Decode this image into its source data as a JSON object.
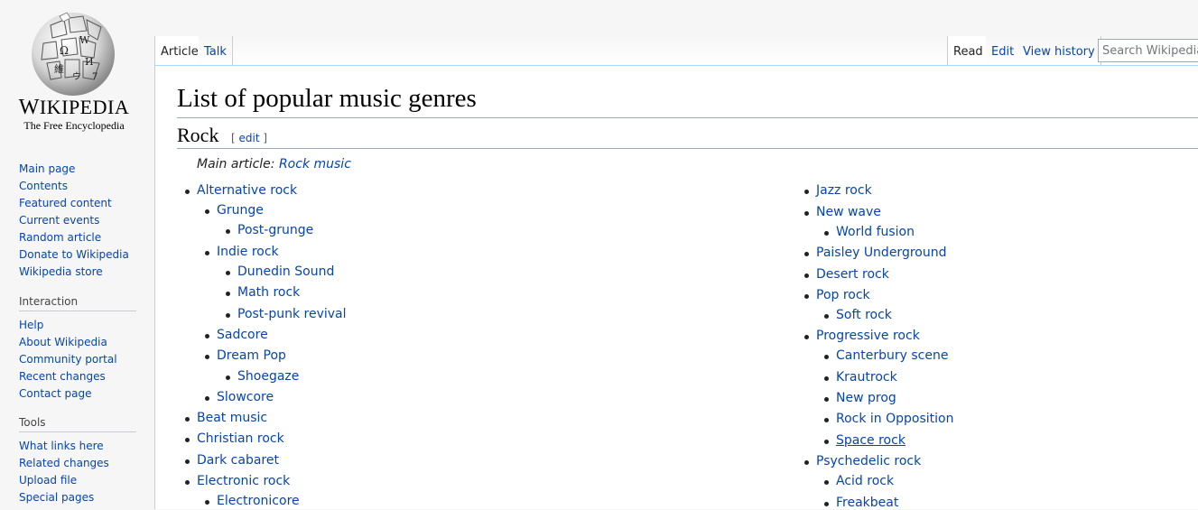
{
  "logo": {
    "wordmark_big": "W",
    "wordmark_rest": "IKIPEDIA",
    "tagline": "The Free Encyclopedia"
  },
  "sidebar": {
    "navigation": [
      "Main page",
      "Contents",
      "Featured content",
      "Current events",
      "Random article",
      "Donate to Wikipedia",
      "Wikipedia store"
    ],
    "interaction": {
      "heading": "Interaction",
      "items": [
        "Help",
        "About Wikipedia",
        "Community portal",
        "Recent changes",
        "Contact page"
      ]
    },
    "tools": {
      "heading": "Tools",
      "items": [
        "What links here",
        "Related changes",
        "Upload file",
        "Special pages"
      ]
    }
  },
  "tabs": {
    "article": "Article",
    "talk": "Talk",
    "read": "Read",
    "edit": "Edit",
    "history": "View history"
  },
  "search": {
    "placeholder": "Search Wikipedia"
  },
  "article": {
    "title": "List of popular music genres",
    "section": "Rock",
    "edit_link": "edit",
    "hatnote_prefix": "Main article: ",
    "hatnote_link": "Rock music"
  },
  "genres_left": [
    {
      "label": "Alternative rock",
      "level": 0
    },
    {
      "label": "Grunge",
      "level": 1
    },
    {
      "label": "Post-grunge",
      "level": 2
    },
    {
      "label": "Indie rock",
      "level": 1
    },
    {
      "label": "Dunedin Sound",
      "level": 2
    },
    {
      "label": "Math rock",
      "level": 2
    },
    {
      "label": "Post-punk revival",
      "level": 2
    },
    {
      "label": "Sadcore",
      "level": 1
    },
    {
      "label": "Dream Pop",
      "level": 1
    },
    {
      "label": "Shoegaze",
      "level": 2
    },
    {
      "label": "Slowcore",
      "level": 1
    },
    {
      "label": "Beat music",
      "level": 0
    },
    {
      "label": "Christian rock",
      "level": 0
    },
    {
      "label": "Dark cabaret",
      "level": 0
    },
    {
      "label": "Electronic rock",
      "level": 0
    },
    {
      "label": "Electronicore",
      "level": 1
    }
  ],
  "genres_right": [
    {
      "label": "Jazz rock",
      "level": 0
    },
    {
      "label": "New wave",
      "level": 0
    },
    {
      "label": "World fusion",
      "level": 1
    },
    {
      "label": "Paisley Underground",
      "level": 0
    },
    {
      "label": "Desert rock",
      "level": 0
    },
    {
      "label": "Pop rock",
      "level": 0
    },
    {
      "label": "Soft rock",
      "level": 1
    },
    {
      "label": "Progressive rock",
      "level": 0
    },
    {
      "label": "Canterbury scene",
      "level": 1
    },
    {
      "label": "Krautrock",
      "level": 1
    },
    {
      "label": "New prog",
      "level": 1
    },
    {
      "label": "Rock in Opposition",
      "level": 1
    },
    {
      "label": "Space rock",
      "level": 1,
      "hover": true
    },
    {
      "label": "Psychedelic rock",
      "level": 0
    },
    {
      "label": "Acid rock",
      "level": 1
    },
    {
      "label": "Freakbeat",
      "level": 1
    }
  ]
}
